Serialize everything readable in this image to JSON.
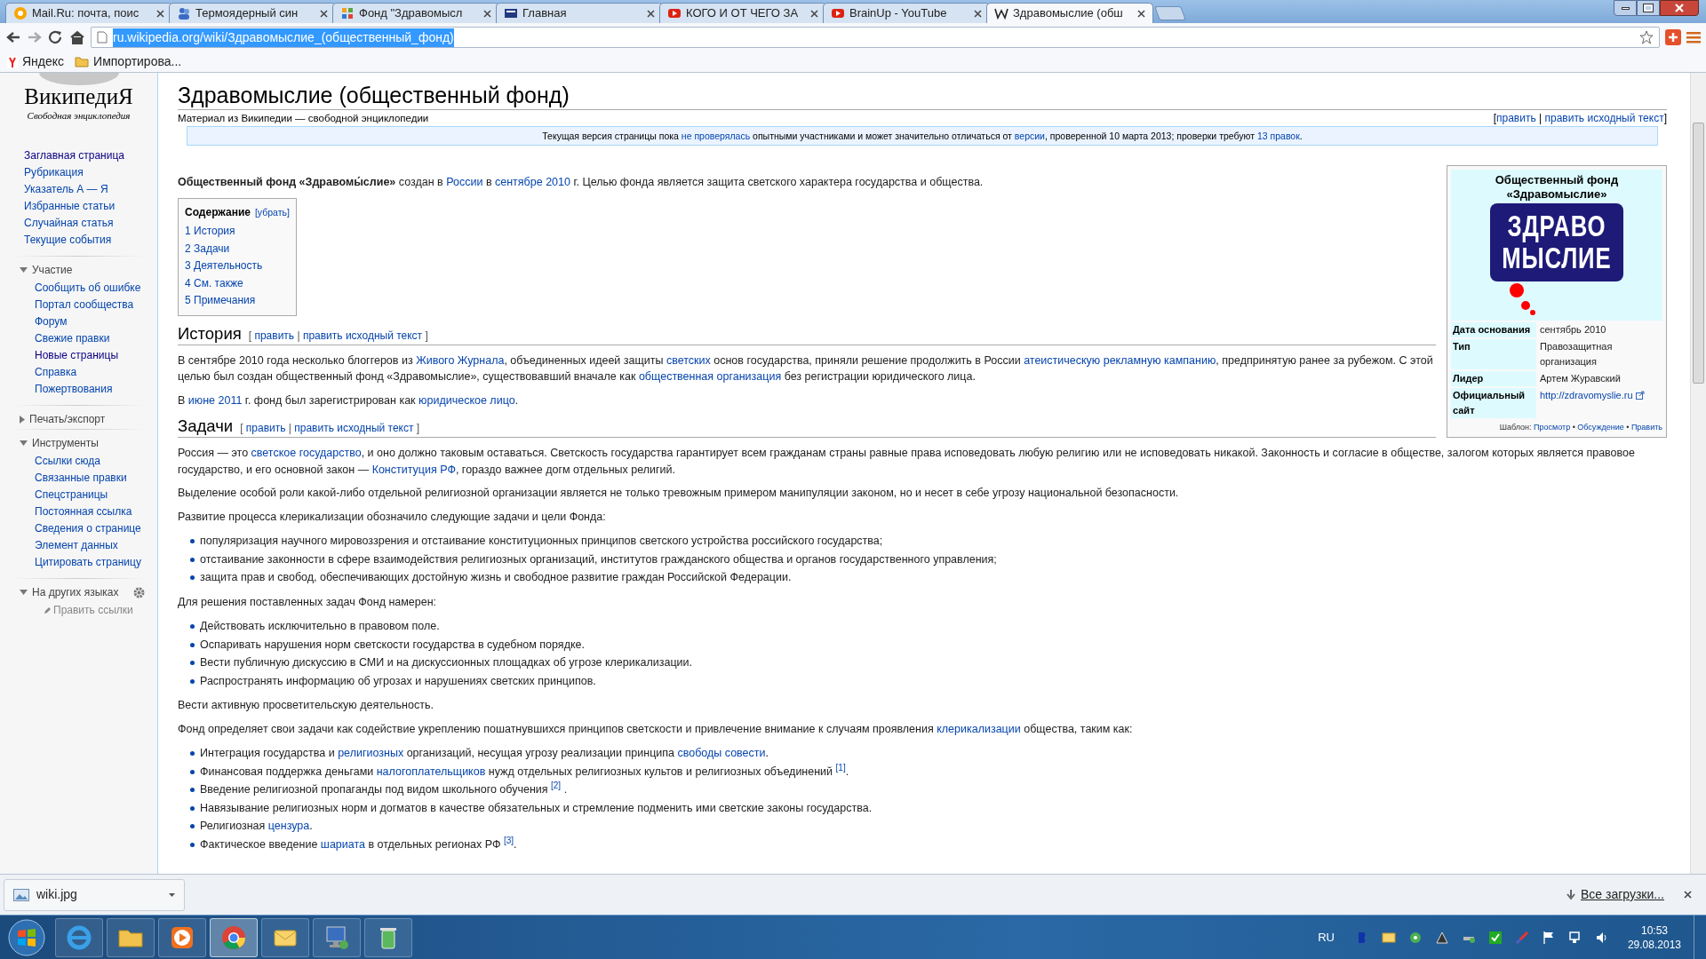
{
  "browser": {
    "tabs": [
      {
        "title": "Mail.Ru: почта, поис",
        "selected": false
      },
      {
        "title": "Термоядерный син",
        "selected": false
      },
      {
        "title": "Фонд \"Здравомысл",
        "selected": false
      },
      {
        "title": "Главная",
        "selected": false
      },
      {
        "title": "КОГО И ОТ ЧЕГО ЗА",
        "selected": false
      },
      {
        "title": "BrainUp - YouTube",
        "selected": false
      },
      {
        "title": "Здравомыслие (обш",
        "selected": true
      }
    ],
    "url": "ru.wikipedia.org/wiki/Здравомыслие_(общественный_фонд)",
    "url_selected": true,
    "bookmarks": [
      {
        "label": "Яндекс",
        "kind": "site"
      },
      {
        "label": "Импортирова...",
        "kind": "folder"
      }
    ]
  },
  "sidebar": {
    "logo_title": "ВикипедиЯ",
    "logo_subtitle": "Свободная энциклопедия",
    "nav": [
      {
        "label": "Заглавная страница",
        "visited": true
      },
      {
        "label": "Рубрикация",
        "visited": false
      },
      {
        "label": "Указатель А — Я",
        "visited": false
      },
      {
        "label": "Избранные статьи",
        "visited": false
      },
      {
        "label": "Случайная статья",
        "visited": false
      },
      {
        "label": "Текущие события",
        "visited": false
      }
    ],
    "sections": [
      {
        "title": "Участие",
        "expanded": true,
        "items": [
          {
            "label": "Сообщить об ошибке",
            "visited": false
          },
          {
            "label": "Портал сообщества",
            "visited": false
          },
          {
            "label": "Форум",
            "visited": false
          },
          {
            "label": "Свежие правки",
            "visited": false
          },
          {
            "label": "Новые страницы",
            "visited": true
          },
          {
            "label": "Справка",
            "visited": false
          },
          {
            "label": "Пожертвования",
            "visited": false
          }
        ]
      },
      {
        "title": "Печать/экспорт",
        "expanded": false
      },
      {
        "title": "Инструменты",
        "expanded": true,
        "items": [
          {
            "label": "Ссылки сюда",
            "visited": false
          },
          {
            "label": "Связанные правки",
            "visited": false
          },
          {
            "label": "Спецстраницы",
            "visited": false
          },
          {
            "label": "Постоянная ссылка",
            "visited": false
          },
          {
            "label": "Сведения о странице",
            "visited": false
          },
          {
            "label": "Элемент данных",
            "visited": false
          },
          {
            "label": "Цитировать страницу",
            "visited": false
          }
        ]
      },
      {
        "title": "На других языках",
        "expanded": true,
        "settings": true,
        "edit_links": "Править ссылки"
      }
    ]
  },
  "article": {
    "title": "Здравомыслие (общественный фонд)",
    "subtitle": "Материал из Википедии — свободной энциклопедии",
    "edit": [
      "[",
      {
        "link": "править"
      },
      " | ",
      {
        "link": "править исходный текст"
      },
      "]"
    ],
    "notice": [
      "Текущая версия страницы пока ",
      {
        "link": "не проверялась"
      },
      " опытными участниками и может значительно отличаться от ",
      {
        "link": "версии"
      },
      ", проверенной 10 марта 2013; проверки требуют ",
      {
        "link": "13 правок"
      },
      "."
    ],
    "lead": [
      "**Общественный фонд «Здравомы́слие»** создан в ",
      {
        "link": "России"
      },
      " в ",
      {
        "link": "сентябре 2010"
      },
      " г. Целью фонда является защита светского характера государства и общества."
    ],
    "toc": {
      "title": "Содержание",
      "toggle": "[убрать]",
      "items": [
        "1 История",
        "2 Задачи",
        "3 Деятельность",
        "4 См. также",
        "5 Примечания"
      ]
    },
    "sections": [
      {
        "heading": "История",
        "edit": [
          "[ ",
          {
            "link": "править"
          },
          " | ",
          {
            "link": "править исходный текст"
          },
          " ]"
        ],
        "blocks": [
          {
            "kind": "p",
            "segs": [
              "В сентябре 2010 года несколько блоггеров из ",
              {
                "link": "Живого Журнала"
              },
              ", объединенных идеей защиты ",
              {
                "link": "светских"
              },
              " основ государства, приняли решение продолжить в России ",
              {
                "link": "атеистическую рекламную кампанию"
              },
              ", предпринятую ранее за рубежом. С этой целью был создан общественный фонд «Здравомыслие», существовавший вначале как ",
              {
                "link": "общественная организация"
              },
              " без регистрации юридического лица."
            ]
          },
          {
            "kind": "p",
            "segs": [
              "В ",
              {
                "link": "июне 2011"
              },
              " г. фонд был зарегистрирован как ",
              {
                "link": "юридическое лицо"
              },
              "."
            ]
          }
        ]
      },
      {
        "heading": "Задачи",
        "edit": [
          "[ ",
          {
            "link": "править"
          },
          " | ",
          {
            "link": "править исходный текст"
          },
          " ]"
        ],
        "blocks": [
          {
            "kind": "p",
            "segs": [
              "Россия — это ",
              {
                "link": "светское государство"
              },
              ", и оно должно таковым оставаться. Светскость государства гарантирует всем гражданам страны равные права исповедовать любую религию или не исповедовать никакой.  Законность и согласие в обществе, залогом которых является правовое государство, и его основной закон — ",
              {
                "link": "Конституция РФ"
              },
              ", гораздо важнее догм отдельных религий."
            ]
          },
          {
            "kind": "p",
            "segs": [
              "Выделение особой роли какой-либо отдельной религиозной организации является не только тревожным примером манипуляции законом, но и несет в себе угрозу национальной безопасности."
            ]
          },
          {
            "kind": "p",
            "segs": [
              "Развитие процесса клерикализации обозначило следующие задачи и цели Фонда:"
            ]
          },
          {
            "kind": "ul",
            "items": [
              [
                "популяризация научного мировоззрения и отстаивание конституционных принципов светского устройства российского государства;"
              ],
              [
                "отстаивание законности в сфере взаимодействия религиозных организаций, институтов гражданского общества и органов государственного управления;"
              ],
              [
                "защита прав и свобод, обеспечивающих достойную жизнь и свободное развитие граждан Российской Федерации."
              ]
            ]
          },
          {
            "kind": "p",
            "segs": [
              "Для решения поставленных задач Фонд намерен:"
            ]
          },
          {
            "kind": "ul",
            "items": [
              [
                "Действовать исключительно в правовом поле."
              ],
              [
                "Оспаривать нарушения норм светскости государства в судебном порядке."
              ],
              [
                "Вести публичную дискуссию в СМИ и на дискуссионных площадках об угрозе клерикализации."
              ],
              [
                "Распространять информацию об угрозах и нарушениях светских принципов."
              ]
            ]
          },
          {
            "kind": "p",
            "segs": [
              "Вести активную просветительскую деятельность."
            ]
          },
          {
            "kind": "p",
            "segs": [
              "Фонд определяет свои задачи как содействие укреплению пошатнувшихся принципов светскости и привлечение внимание к случаям проявления ",
              {
                "link": "клерикализации"
              },
              " общества, таким как:"
            ]
          },
          {
            "kind": "ul",
            "items": [
              [
                "Интеграция государства и ",
                {
                  "link": "религиозных"
                },
                " организаций, несущая угрозу реализации принципа ",
                {
                  "link": "свободы совести"
                },
                "."
              ],
              [
                "Финансовая поддержка деньгами ",
                {
                  "link": "налогоплательщиков"
                },
                " нужд отдельных религиозных культов и религиозных объединений ",
                {
                  "ref": "[1]"
                },
                "."
              ],
              [
                "Введение религиозной пропаганды под видом школьного обучения ",
                {
                  "ref": "[2]"
                },
                " ."
              ],
              [
                "Навязывание религиозных норм и догматов в качестве обязательных и стремление подменить ими светские законы государства."
              ],
              [
                "Религиозная ",
                {
                  "link": "цензура"
                },
                "."
              ],
              [
                "Фактическое введение ",
                {
                  "link": "шариата"
                },
                " в отдельных регионах РФ ",
                {
                  "ref": "[3]"
                },
                "."
              ]
            ]
          }
        ]
      }
    ]
  },
  "infobox": {
    "title": "Общественный фонд «Здравомыслие»",
    "logo_lines": [
      "ЗДРАВО",
      "МЫСЛИЕ"
    ],
    "rows": [
      {
        "label": "Дата основания",
        "value": "сентябрь 2010",
        "kind": "text"
      },
      {
        "label": "Тип",
        "value": "Правозащитная организация",
        "kind": "text"
      },
      {
        "label": "Лидер",
        "value": "Артем Журавский",
        "kind": "text"
      },
      {
        "label": "Официальный сайт",
        "value": "http://zdravomyslie.ru",
        "kind": "external"
      }
    ],
    "footer": [
      "Шаблон: ",
      {
        "link": "Просмотр"
      },
      " • ",
      {
        "link": "Обсуждение"
      },
      " • ",
      {
        "link": "Править"
      }
    ]
  },
  "downloads": {
    "file": "wiki.jpg",
    "all": "Все загрузки..."
  },
  "taskbar": {
    "apps": [
      {
        "selected": false
      },
      {
        "selected": false
      },
      {
        "selected": false
      },
      {
        "selected": true
      },
      {
        "selected": false
      },
      {
        "selected": false
      },
      {
        "selected": false
      }
    ],
    "lang": "RU",
    "time": "10:53",
    "date": "29.08.2013"
  }
}
